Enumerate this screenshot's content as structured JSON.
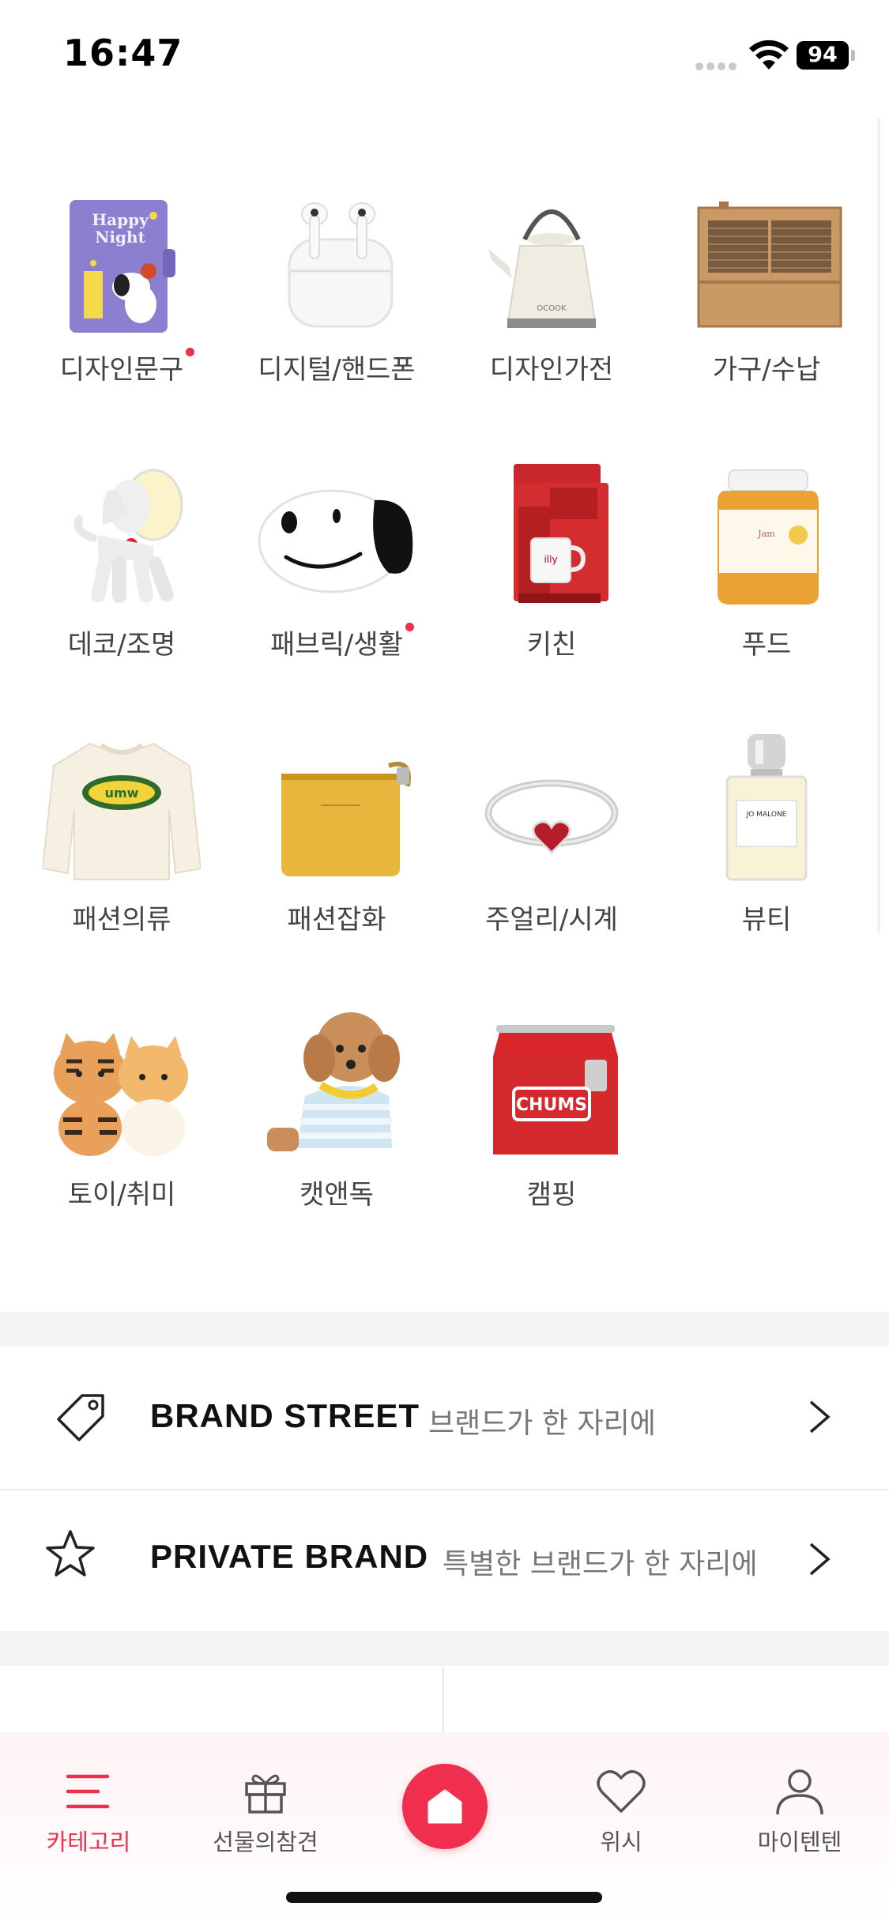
{
  "status_bar": {
    "time": "16:47",
    "battery": "94"
  },
  "categories": [
    {
      "label": "디자인문구",
      "new": true,
      "icon": "planner-icon"
    },
    {
      "label": "디지털/핸드폰",
      "new": false,
      "icon": "earbuds-icon"
    },
    {
      "label": "디자인가전",
      "new": false,
      "icon": "kettle-icon"
    },
    {
      "label": "가구/수납",
      "new": false,
      "icon": "cabinet-icon"
    },
    {
      "label": "데코/조명",
      "new": false,
      "icon": "dog-lamp-icon"
    },
    {
      "label": "패브릭/생활",
      "new": true,
      "icon": "snoopy-cushion-icon"
    },
    {
      "label": "키친",
      "new": false,
      "icon": "coffee-machine-icon"
    },
    {
      "label": "푸드",
      "new": false,
      "icon": "jam-jar-icon"
    },
    {
      "label": "패션의류",
      "new": false,
      "icon": "sweatshirt-icon"
    },
    {
      "label": "패션잡화",
      "new": false,
      "icon": "pouch-icon"
    },
    {
      "label": "주얼리/시계",
      "new": false,
      "icon": "ring-icon"
    },
    {
      "label": "뷰티",
      "new": false,
      "icon": "perfume-icon"
    },
    {
      "label": "토이/취미",
      "new": false,
      "icon": "tiger-figures-icon"
    },
    {
      "label": "캣앤독",
      "new": false,
      "icon": "puppy-icon"
    },
    {
      "label": "캠핑",
      "new": false,
      "icon": "cooler-icon"
    }
  ],
  "brand_links": [
    {
      "title": "BRAND STREET",
      "subtitle": "브랜드가 한 자리에",
      "icon": "tag-icon"
    },
    {
      "title": "PRIVATE BRAND",
      "subtitle": "특별한 브랜드가 한 자리에",
      "icon": "star-icon"
    }
  ],
  "tab_bar": {
    "tabs": [
      {
        "label": "카테고리",
        "icon": "menu-icon",
        "active": true
      },
      {
        "label": "선물의참견",
        "icon": "gift-icon",
        "active": false
      },
      {
        "label": "위시",
        "icon": "heart-icon",
        "active": false
      },
      {
        "label": "마이텐텐",
        "icon": "person-icon",
        "active": false
      }
    ],
    "home_icon": "home-icon"
  },
  "colors": {
    "accent": "#ef2f4d",
    "text": "#444444",
    "subtext": "#777777"
  }
}
